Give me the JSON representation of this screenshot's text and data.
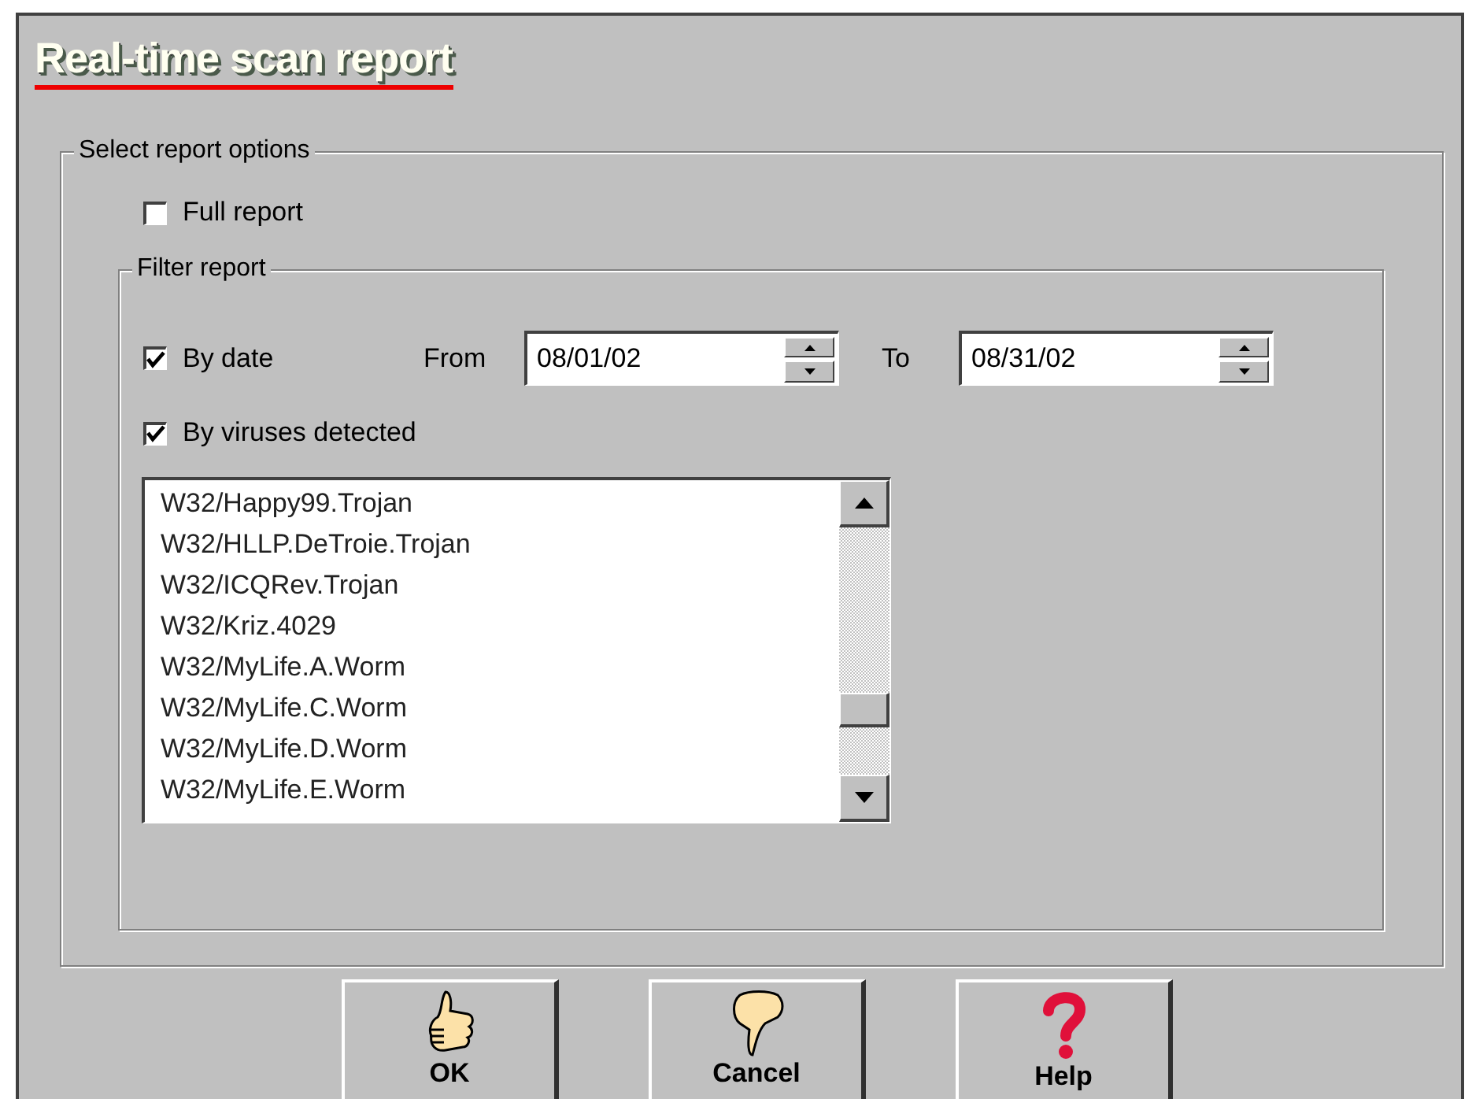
{
  "title": "Real-time scan report",
  "options_group": {
    "label": "Select report options",
    "full_report": {
      "label": "Full report",
      "checked": false
    },
    "filter_group": {
      "label": "Filter report",
      "by_date": {
        "label": "By date",
        "checked": true,
        "from_label": "From",
        "from_value": "08/01/02",
        "to_label": "To",
        "to_value": "08/31/02"
      },
      "by_viruses": {
        "label": "By viruses detected",
        "checked": true
      },
      "viruses": [
        "W32/Happy99.Trojan",
        "W32/HLLP.DeTroie.Trojan",
        "W32/ICQRev.Trojan",
        "W32/Kriz.4029",
        "W32/MyLife.A.Worm",
        "W32/MyLife.C.Worm",
        "W32/MyLife.D.Worm",
        "W32/MyLife.E.Worm"
      ]
    }
  },
  "buttons": [
    {
      "kind": "ok",
      "label": "OK"
    },
    {
      "kind": "cancel",
      "label": "Cancel"
    },
    {
      "kind": "help",
      "label": "Help"
    }
  ]
}
